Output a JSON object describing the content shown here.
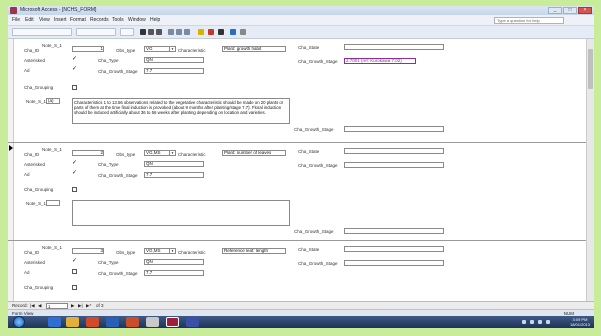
{
  "window": {
    "title": "Microsoft Access - [NCHS_FORM]",
    "buttons": [
      "_",
      "□",
      "×"
    ]
  },
  "menu": {
    "items": [
      "File",
      "Edit",
      "View",
      "Insert",
      "Format",
      "Records",
      "Tools",
      "Window",
      "Help"
    ],
    "help_box": "Type a question for help"
  },
  "labels": {
    "cha_id": "Cha_ID",
    "note_s": "Note_S_1",
    "asterisked": "Asterisked",
    "ad": "Ad",
    "obs_type": "Obs_type",
    "cha_type": "Cha_Type",
    "cha_growth_stage": "Cha_Growth_Stage",
    "characteristic": "Characteristic",
    "cha_state": "Cha_State",
    "cha_grouping": "Cha_Grouping",
    "note_s1": "Note_S_1"
  },
  "records": [
    {
      "cha_id": "1",
      "asterisked": "✓",
      "ad": "✓",
      "obs_type": "VG",
      "cha_type": "QN",
      "growth_stage": "7.7",
      "characteristic": "Plant: growth habit",
      "state": "",
      "growth_stage_right": "",
      "growth_stage_right2": "2.7001 (ref: Kurokawa 7.02)",
      "grouping": "",
      "note_value": "(a)",
      "note_text": "Characteristics 1 to 13.56 observations related to the vegetative characteristic should be made on 20 plants or parts of them at the time final induction is provoked (about 9 months after planting/stage 7.7). Floral induction should be induced artificially about 36 to 56 weeks after planting depending on location and varieties.",
      "bottom_growth_stage": ""
    },
    {
      "cha_id": "2",
      "asterisked": "✓",
      "ad": "✓",
      "obs_type": "VG,MS",
      "cha_type": "QN",
      "growth_stage": "7.7",
      "characteristic": "Plant: number of leaves",
      "state": "",
      "growth_stage_right": "",
      "growth_stage_right2": "",
      "grouping": "",
      "note_value": "",
      "note_text": "",
      "bottom_growth_stage": ""
    },
    {
      "cha_id": "3",
      "asterisked": "✓",
      "ad": "",
      "obs_type": "VG,MS",
      "cha_type": "QN",
      "growth_stage": "7.7",
      "characteristic": "Reference leaf: length",
      "state": "",
      "growth_stage_right": "",
      "growth_stage_right2": "",
      "grouping": "",
      "note_value": "",
      "note_text": "",
      "bottom_growth_stage": ""
    }
  ],
  "navigation": {
    "record_label": "Record:",
    "current": "1",
    "of_text": "of 3"
  },
  "status": {
    "left": "Form View",
    "right": "NUM"
  },
  "taskbar": {
    "time": "3:09 PM",
    "date": "18/01/2013"
  },
  "colors": {
    "background": "#c8ec9a",
    "purple_text": "#8b2f9c"
  }
}
